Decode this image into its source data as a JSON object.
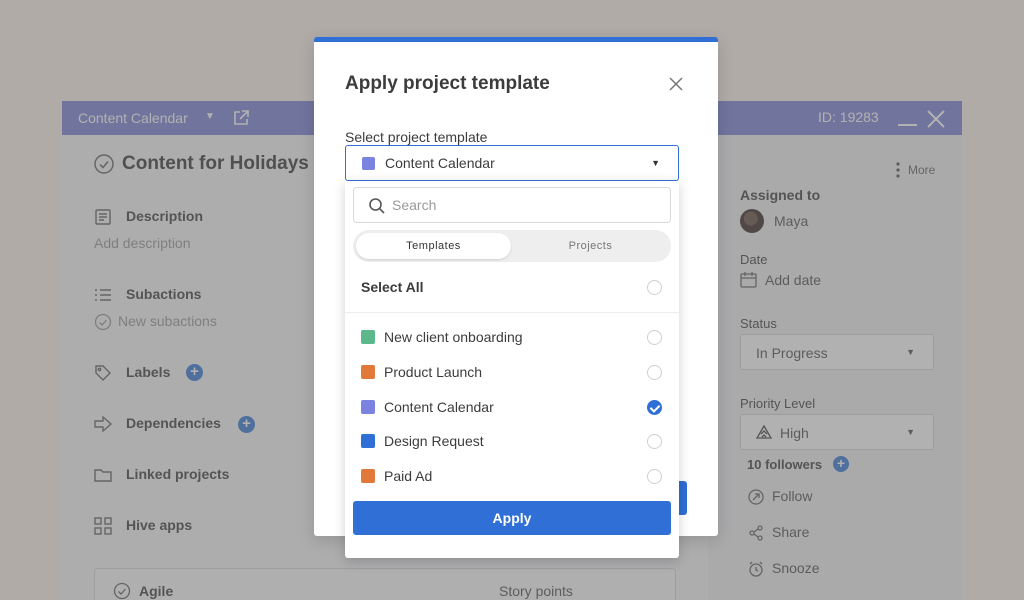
{
  "window": {
    "title": "Content Calendar",
    "id_label": "ID: 19283"
  },
  "task": {
    "title": "Content for Holidays",
    "description_label": "Description",
    "description_placeholder": "Add description",
    "subactions_label": "Subactions",
    "subactions_placeholder": "New subactions",
    "labels_label": "Labels",
    "dependencies_label": "Dependencies",
    "linked_projects_label": "Linked projects",
    "hive_apps_label": "Hive apps",
    "agile_label": "Agile",
    "story_points_label": "Story points",
    "add_symbol": "+"
  },
  "sidebar": {
    "more_label": "More",
    "assigned_to_label": "Assigned to",
    "assignee_name": "Maya",
    "date_label": "Date",
    "date_placeholder": "Add date",
    "status_label": "Status",
    "status_value": "In Progress",
    "priority_label": "Priority Level",
    "priority_value": "High",
    "followers_label": "10 followers",
    "actions": [
      {
        "label": "Follow",
        "icon": "follow-icon"
      },
      {
        "label": "Share",
        "icon": "share-icon"
      },
      {
        "label": "Snooze",
        "icon": "alarm-clock-icon"
      }
    ]
  },
  "modal": {
    "title": "Apply project template",
    "select_label": "Select project template",
    "selected_value": "Content Calendar",
    "selected_color": "#7b82e0"
  },
  "dropdown": {
    "search_placeholder": "Search",
    "tabs": [
      {
        "label": "Templates",
        "active": true
      },
      {
        "label": "Projects",
        "active": false
      }
    ],
    "select_all_label": "Select All",
    "items": [
      {
        "label": "New client onboarding",
        "color": "#5cb88a",
        "checked": false
      },
      {
        "label": "Product Launch",
        "color": "#e0793a",
        "checked": false
      },
      {
        "label": "Content Calendar",
        "color": "#7b82e0",
        "checked": true
      },
      {
        "label": "Design Request",
        "color": "#2f6fd6",
        "checked": false
      },
      {
        "label": "Paid Ad",
        "color": "#e0793a",
        "checked": false
      }
    ],
    "apply_label": "Apply"
  },
  "colors": {
    "accent": "#2f6fd6",
    "titlebar": "#7e85d6",
    "page_background": "#fdf3ea"
  }
}
